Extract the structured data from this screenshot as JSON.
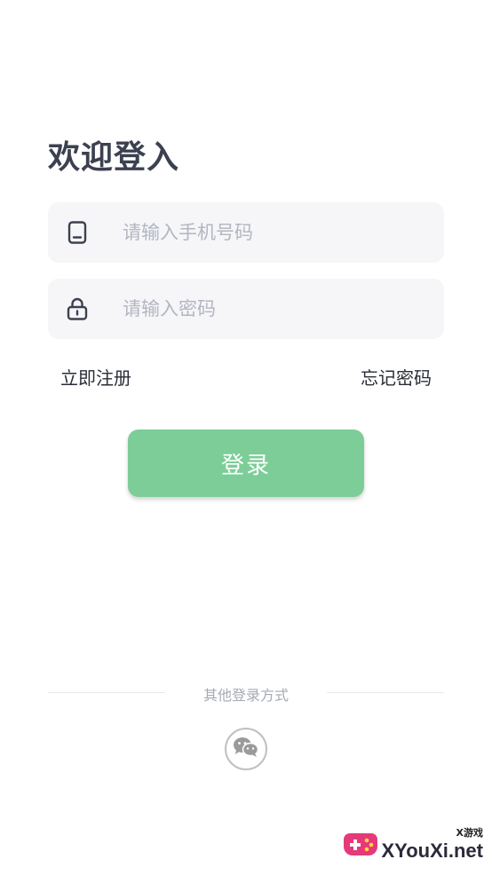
{
  "login": {
    "title": "欢迎登入",
    "phone_placeholder": "请输入手机号码",
    "password_placeholder": "请输入密码",
    "register_link": "立即注册",
    "forgot_link": "忘记密码",
    "login_button": "登录"
  },
  "other_login": {
    "label": "其他登录方式",
    "wechat_icon": "wechat-icon"
  },
  "watermark": {
    "small_text": "X游戏",
    "big_text": "XYouXi.net"
  },
  "colors": {
    "primary_button": "#7dcd98",
    "field_bg": "#f6f6f8",
    "title": "#3c4150",
    "placeholder": "#b2b6c2"
  }
}
